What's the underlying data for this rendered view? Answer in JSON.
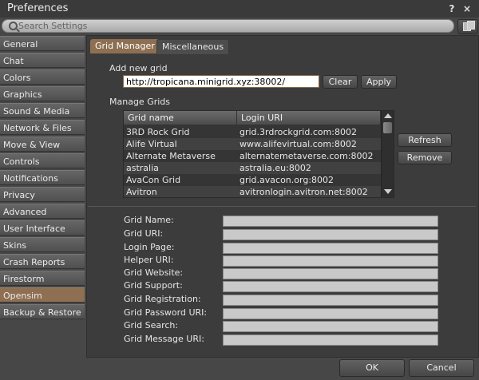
{
  "window": {
    "title": "Preferences",
    "help_glyph": "?",
    "close_glyph": "×"
  },
  "search": {
    "placeholder": "Search Settings"
  },
  "sidebar": {
    "items": [
      {
        "label": "General"
      },
      {
        "label": "Chat"
      },
      {
        "label": "Colors"
      },
      {
        "label": "Graphics"
      },
      {
        "label": "Sound & Media"
      },
      {
        "label": "Network & Files"
      },
      {
        "label": "Move & View"
      },
      {
        "label": "Controls"
      },
      {
        "label": "Notifications"
      },
      {
        "label": "Privacy"
      },
      {
        "label": "Advanced"
      },
      {
        "label": "User Interface"
      },
      {
        "label": "Skins"
      },
      {
        "label": "Crash Reports"
      },
      {
        "label": "Firestorm"
      },
      {
        "label": "Opensim"
      },
      {
        "label": "Backup & Restore"
      }
    ],
    "active_index": 15
  },
  "tabs": [
    {
      "label": "Grid Manager"
    },
    {
      "label": "Miscellaneous"
    }
  ],
  "add_grid": {
    "label": "Add new grid",
    "url_value": "http://tropicana.minigrid.xyz:38002/",
    "clear_label": "Clear",
    "apply_label": "Apply"
  },
  "manage": {
    "label": "Manage Grids",
    "columns": [
      "Grid name",
      "Login URI"
    ],
    "rows": [
      {
        "name": "3RD Rock Grid",
        "uri": "grid.3rdrockgrid.com:8002"
      },
      {
        "name": "Alife Virtual",
        "uri": "www.alifevirtual.com:8002"
      },
      {
        "name": "Alternate Metaverse",
        "uri": "alternatemetaverse.com:8002"
      },
      {
        "name": "astralia",
        "uri": "astralia.eu:8002"
      },
      {
        "name": "AvaCon Grid",
        "uri": "grid.avacon.org:8002"
      },
      {
        "name": "Avitron",
        "uri": "avitronlogin.avitron.net:8002"
      }
    ],
    "refresh_label": "Refresh",
    "remove_label": "Remove"
  },
  "details": {
    "fields": [
      {
        "label": "Grid Name:"
      },
      {
        "label": "Grid URI:"
      },
      {
        "label": "Login Page:"
      },
      {
        "label": "Helper URI:"
      },
      {
        "label": "Grid Website:"
      },
      {
        "label": "Grid Support:"
      },
      {
        "label": "Grid Registration:"
      },
      {
        "label": "Grid Password URI:"
      },
      {
        "label": "Grid Search:"
      },
      {
        "label": "Grid Message URI:"
      }
    ]
  },
  "footer": {
    "ok_label": "OK",
    "cancel_label": "Cancel"
  }
}
